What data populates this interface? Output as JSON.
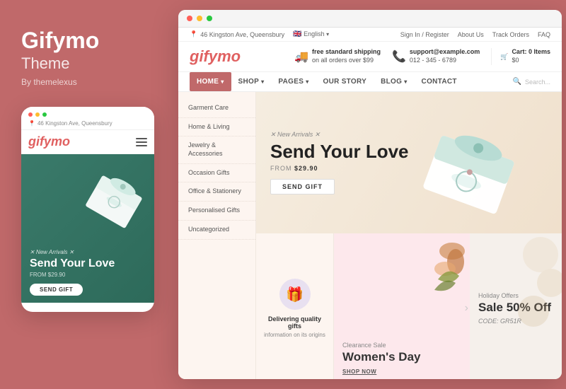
{
  "leftPanel": {
    "brandTitle": "Gifymo",
    "brandSubtitle": "Theme",
    "brandBy": "By themelexus"
  },
  "mobile": {
    "address": "46 Kingston Ave, Queensbury",
    "logo": "gifymo",
    "dots": [
      "red",
      "yellow",
      "green"
    ],
    "heroBadge": "✕ New Arrivals ✕",
    "heroTitle": "Send Your Love",
    "heroFrom": "FROM",
    "heroPrice": "$29.90",
    "heroBtnLabel": "SEND GIFT"
  },
  "browser": {
    "dots": [
      "red",
      "yellow",
      "green"
    ]
  },
  "topbar": {
    "address": "46 Kingston Ave, Queensbury",
    "language": "English",
    "signIn": "Sign In / Register",
    "about": "About Us",
    "track": "Track Orders",
    "faq": "FAQ"
  },
  "mainbar": {
    "logo": "gifymo",
    "shipping": {
      "title": "free standard shipping",
      "sub": "on all orders over $99"
    },
    "support": {
      "email": "support@example.com",
      "phone": "012 - 345 - 6789"
    },
    "cart": {
      "label": "Cart:",
      "items": "0 Items",
      "price": "$0"
    }
  },
  "nav": {
    "items": [
      {
        "label": "HOME",
        "active": true,
        "hasChevron": true
      },
      {
        "label": "SHOP",
        "active": false,
        "hasChevron": true
      },
      {
        "label": "PAGES",
        "active": false,
        "hasChevron": true
      },
      {
        "label": "OUR STORY",
        "active": false,
        "hasChevron": false
      },
      {
        "label": "BLOG",
        "active": false,
        "hasChevron": true
      },
      {
        "label": "CONTACT",
        "active": false,
        "hasChevron": false
      }
    ],
    "searchPlaceholder": "Search..."
  },
  "sidebar": {
    "items": [
      "Garment Care",
      "Home & Living",
      "Jewelry & Accessories",
      "Occasion Gifts",
      "Office & Stationery",
      "Personalised Gifts",
      "Uncategorized"
    ]
  },
  "hero": {
    "badge": "✕ New Arrivals ✕",
    "title": "Send Your Love",
    "fromLabel": "FROM",
    "price": "$29.90",
    "btnLabel": "SEND GIFT"
  },
  "cards": {
    "deliver": {
      "title": "Delivering quality gifts",
      "sub": "information on its origins"
    },
    "womens": {
      "label": "Clearance Sale",
      "title": "Women's Day",
      "btnLabel": "SHOP NOW"
    },
    "holiday": {
      "label": "Holiday Offers",
      "title": "Sale 50% Off",
      "code": "CODE: GR51R"
    }
  }
}
